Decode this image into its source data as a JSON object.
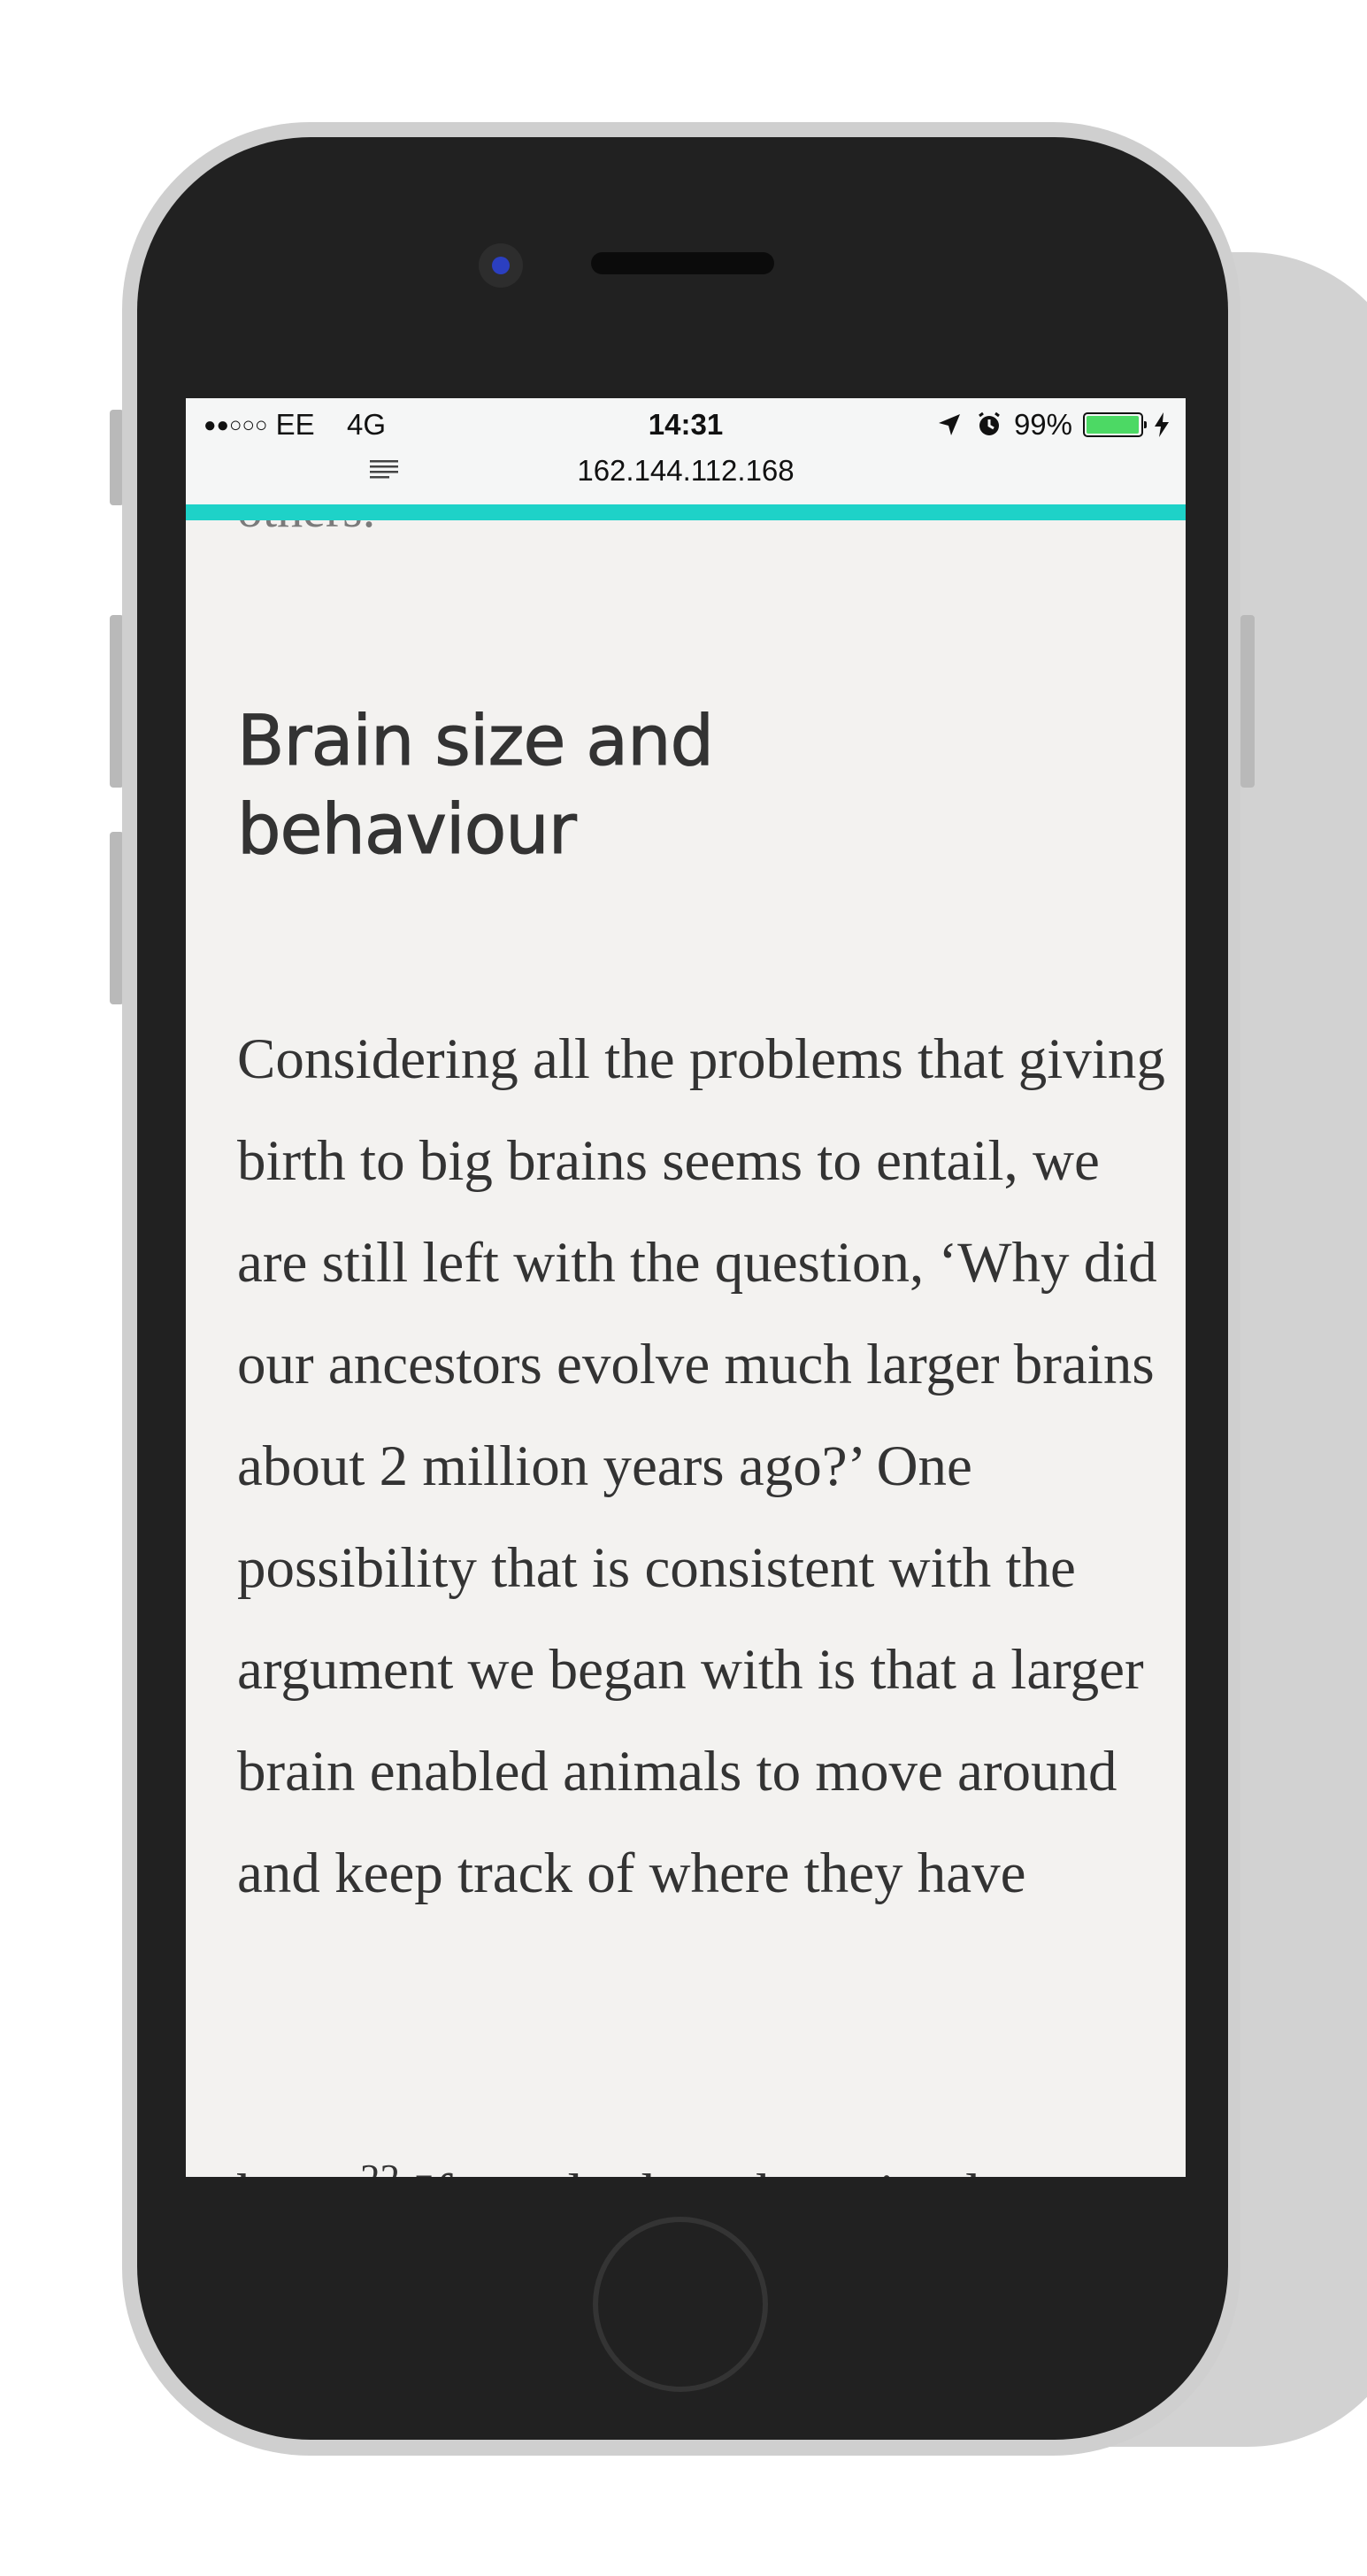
{
  "status_bar": {
    "signal": "●●○○○",
    "carrier": "EE",
    "network": "4G",
    "time": "14:31",
    "battery": "99%",
    "url": "162.144.112.168"
  },
  "article": {
    "previous_fragment": "others.",
    "section_heading": "Brain size and behaviour",
    "paragraph": "Considering all the problems that giving birth to big brains seems to entail, we are still left with the question, ‘Why did our ancestors evolve much larger brains about 2 million years ago?’ One possibility that is consistent with the argument we began with is that a larger brain enabled animals to move around and keep track of where they have",
    "next_line_start": "been.",
    "footnote": "22",
    "next_line_rest": " If you look at the animal"
  },
  "colors": {
    "progress": "#1ed2c8",
    "page_background": "#f3f2f0",
    "text": "#333333",
    "phone_body": "#212121"
  },
  "icons": [
    "location-arrow-icon",
    "alarm-icon",
    "battery-icon",
    "charging-icon",
    "reader-view-icon"
  ]
}
